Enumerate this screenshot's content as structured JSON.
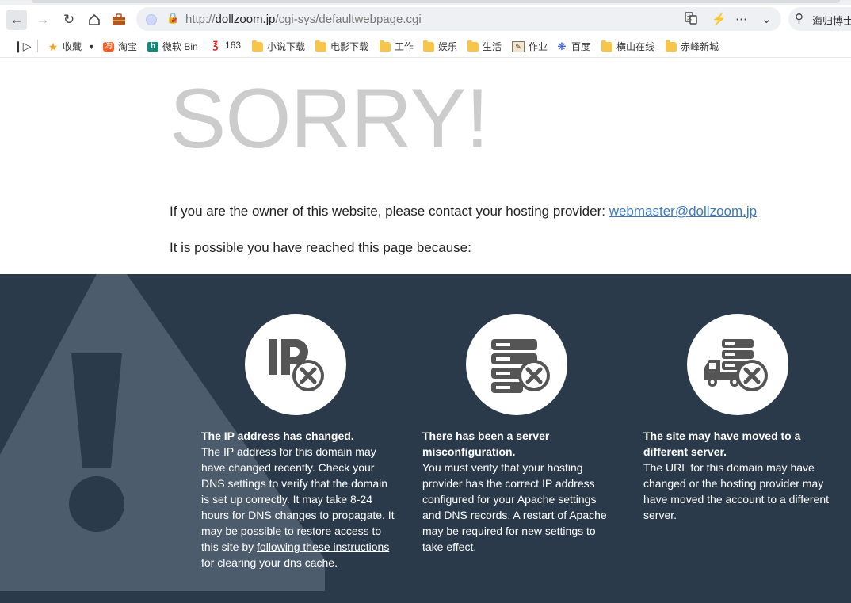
{
  "browser": {
    "url_prefix": "http://",
    "url_domain": "dollzoom.jp",
    "url_path": "/cgi-sys/defaultwebpage.cgi",
    "search_text": "海归博士",
    "bookmarks": [
      {
        "label": "收藏",
        "icon": "star-icon"
      },
      {
        "label": "淘宝",
        "icon": "taobao-icon"
      },
      {
        "label": "微软 Bin",
        "icon": "bing-icon"
      },
      {
        "label": "163",
        "icon": "netease-icon"
      },
      {
        "label": "小说下载",
        "icon": "folder-icon"
      },
      {
        "label": "电影下载",
        "icon": "folder-icon"
      },
      {
        "label": "工作",
        "icon": "folder-icon"
      },
      {
        "label": "娱乐",
        "icon": "folder-icon"
      },
      {
        "label": "生活",
        "icon": "folder-icon"
      },
      {
        "label": "作业",
        "icon": "homework-icon"
      },
      {
        "label": "百度",
        "icon": "baidu-icon"
      },
      {
        "label": "横山在线",
        "icon": "folder-icon"
      },
      {
        "label": "赤峰新城",
        "icon": "folder-icon"
      }
    ]
  },
  "page": {
    "title": "SORRY!",
    "owner_text": "If you are the owner of this website, please contact your hosting provider: ",
    "owner_email": "webmaster@dollzoom.jp",
    "because_text": "It is possible you have reached this page because:",
    "reasons": [
      {
        "heading": "The IP address has changed.",
        "body": "The IP address for this domain may have changed recently. Check your DNS settings to verify that the domain is set up correctly. It may take 8-24 hours for DNS changes to propagate. It may be possible to restore access to this site by ",
        "link": "following these instructions",
        "body_after": " for clearing your dns cache."
      },
      {
        "heading": "There has been a server misconfiguration.",
        "body": "You must verify that your hosting provider has the correct IP address configured for your Apache settings and DNS records. A restart of Apache may be required for new settings to take effect."
      },
      {
        "heading": "The site may have moved to a different server.",
        "body": "The URL for this domain may have changed or the hosting provider may have moved the account to a different server."
      }
    ]
  },
  "colors": {
    "dark_panel": "#2b3a4a",
    "link": "#3c7bbf",
    "sorry_gray": "#cccccc",
    "icon_gray": "#555555"
  }
}
